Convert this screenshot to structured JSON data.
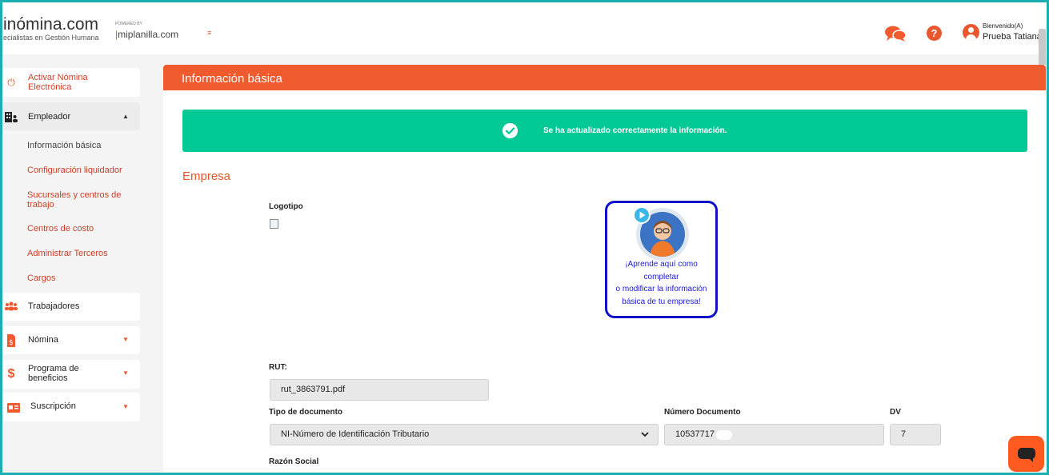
{
  "header": {
    "logo_main": "inómina.com",
    "logo_sub": "ecialistas en Gestión Humana",
    "powered_by": "POWERED BY",
    "partner": "miplanilla.com",
    "welcome": "Bienvenido(A)",
    "user_name": "Prueba Tatiana"
  },
  "sidebar": {
    "items": [
      {
        "label": "Activar Nómina Electrónica",
        "icon": "power-icon"
      },
      {
        "label": "Empleador",
        "icon": "building-user-icon",
        "expanded": true
      },
      {
        "label": "Trabajadores",
        "icon": "users-icon"
      },
      {
        "label": "Nómina",
        "icon": "file-invoice-dollar-icon"
      },
      {
        "label": "Programa de beneficios",
        "icon": "dollar-icon"
      },
      {
        "label": "Suscripción",
        "icon": "id-card-icon"
      }
    ],
    "subitems": [
      "Información básica",
      "Configuración liquidador",
      "Sucursales y centros de trabajo",
      "Centros de costo",
      "Administrar Terceros",
      "Cargos"
    ]
  },
  "main": {
    "title": "Información básica",
    "alert": "Se ha actualizado correctamente la información.",
    "section": "Empresa",
    "logo_label": "Logotipo",
    "help_lines": [
      "¡Aprende aquí como",
      "completar",
      "o modificar la información",
      "básica de tu empresa!"
    ],
    "rut_label": "RUT:",
    "rut_value": "rut_3863791.pdf",
    "doc_type_label": "Tipo de documento",
    "doc_type_value": "NI-Número de Identificación Tributario",
    "doc_number_label": "Número Documento",
    "doc_number_value": "10537717",
    "dv_label": "DV",
    "dv_value": "7",
    "razon_label": "Razón Social"
  },
  "colors": {
    "accent": "#ef5a2f",
    "success": "#00c996",
    "help_border": "#1010c8",
    "frame": "#1aaeb3"
  }
}
